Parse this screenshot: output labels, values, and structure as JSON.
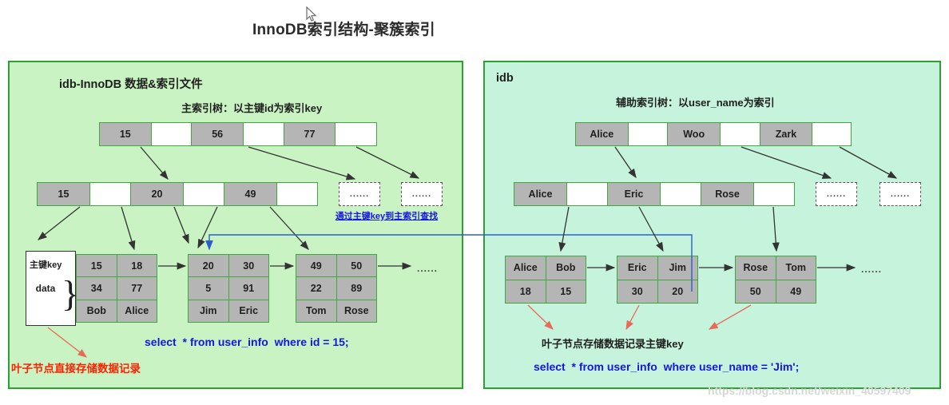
{
  "title": "InnoDB索引结构-聚簇索引",
  "watermark": "https://blog.csdn.net/weixin_40597409",
  "cursor_icon": "mouse-pointer-icon",
  "panels": {
    "primary": {
      "title": "idb-InnoDB 数据&索引文件",
      "tree_title": "主索引树：以主键id为索引key",
      "root_node": {
        "cells": [
          {
            "type": "key",
            "text": "15"
          },
          {
            "type": "ptr",
            "text": ""
          },
          {
            "type": "key",
            "text": "56"
          },
          {
            "type": "ptr",
            "text": ""
          },
          {
            "type": "key",
            "text": "77"
          },
          {
            "type": "ptr",
            "text": ""
          }
        ]
      },
      "level2_node": {
        "cells": [
          {
            "type": "key",
            "text": "15"
          },
          {
            "type": "ptr",
            "text": ""
          },
          {
            "type": "key",
            "text": "20"
          },
          {
            "type": "ptr",
            "text": ""
          },
          {
            "type": "key",
            "text": "49"
          },
          {
            "type": "ptr",
            "text": ""
          }
        ]
      },
      "dashed_nodes": [
        "......",
        "......"
      ],
      "leaf_legend": {
        "key_label": "主键key",
        "data_label": "data",
        "brace": "}"
      },
      "leaves": [
        {
          "rows": [
            [
              "15",
              "18"
            ],
            [
              "34",
              "77"
            ],
            [
              "Bob",
              "Alice"
            ]
          ]
        },
        {
          "rows": [
            [
              "20",
              "30"
            ],
            [
              "5",
              "91"
            ],
            [
              "Jim",
              "Eric"
            ]
          ]
        },
        {
          "rows": [
            [
              "49",
              "50"
            ],
            [
              "22",
              "89"
            ],
            [
              "Tom",
              "Rose"
            ]
          ]
        }
      ],
      "leaf_tail_dots": "......",
      "annotations": {
        "lookup": "通过主键key到主索引查找",
        "sql": "select  * from user_info  where id = 15;",
        "leaf_store": "叶子节点直接存储数据记录"
      }
    },
    "secondary": {
      "title": "idb",
      "tree_title": "辅助索引树：以user_name为索引",
      "root_node": {
        "cells": [
          {
            "type": "key",
            "text": "Alice"
          },
          {
            "type": "ptr",
            "text": ""
          },
          {
            "type": "key",
            "text": "Woo"
          },
          {
            "type": "ptr",
            "text": ""
          },
          {
            "type": "key",
            "text": "Zark"
          },
          {
            "type": "ptr",
            "text": ""
          }
        ]
      },
      "level2_node": {
        "cells": [
          {
            "type": "key",
            "text": "Alice"
          },
          {
            "type": "ptr",
            "text": ""
          },
          {
            "type": "key",
            "text": "Eric"
          },
          {
            "type": "ptr",
            "text": ""
          },
          {
            "type": "key",
            "text": "Rose"
          },
          {
            "type": "ptr",
            "text": ""
          }
        ]
      },
      "dashed_nodes": [
        "......",
        "......"
      ],
      "leaves": [
        {
          "rows": [
            [
              "Alice",
              "Bob"
            ],
            [
              "18",
              "15"
            ]
          ]
        },
        {
          "rows": [
            [
              "Eric",
              "Jim"
            ],
            [
              "30",
              "20"
            ]
          ]
        },
        {
          "rows": [
            [
              "Rose",
              "Tom"
            ],
            [
              "50",
              "49"
            ]
          ]
        }
      ],
      "leaf_tail_dots": "......",
      "annotations": {
        "leaf_store_key": "叶子节点存储数据记录主键key",
        "sql": "select  * from user_info  where user_name = 'Jim';"
      }
    }
  },
  "colors": {
    "panel_border": "#2f9e35",
    "panel_primary_bg": "#c9f3c2",
    "panel_secondary_bg": "#c6f3dc",
    "node_border": "#3fa93f",
    "key_cell_bg": "#b5b5b5",
    "annotation_blue": "#1616e0",
    "annotation_red": "#ff2200",
    "cross_link_blue": "#2a5fd0",
    "leaf_pointer_red": "#e86a5a"
  }
}
